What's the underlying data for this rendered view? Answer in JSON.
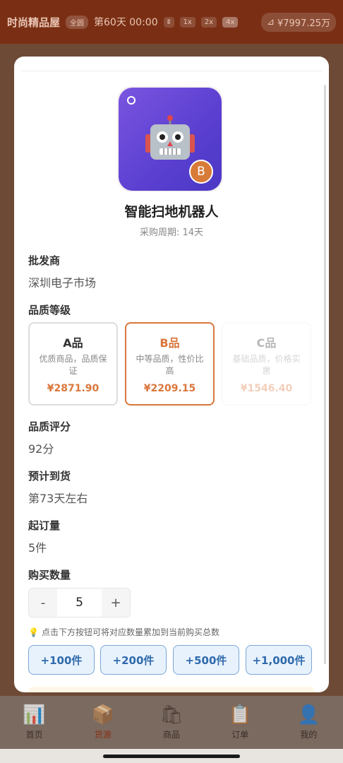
{
  "topbar": {
    "shop_name": "时尚精品屋",
    "mode_badge": "全圆",
    "day": "第60天 00:00",
    "speeds": [
      "Ⅱ",
      "1x",
      "2x",
      "4x"
    ],
    "money": "¥7997.25万"
  },
  "product": {
    "name": "智能扫地机器人",
    "cycle": "采购周期: 14天",
    "grade_badge": "B"
  },
  "wholesaler": {
    "label": "批发商",
    "value": "深圳电子市场"
  },
  "quality": {
    "label": "品质等级",
    "grades": [
      {
        "name": "A品",
        "desc": "优质商品，品质保证",
        "price": "¥2871.90"
      },
      {
        "name": "B品",
        "desc": "中等品质，性价比高",
        "price": "¥2209.15"
      },
      {
        "name": "C品",
        "desc": "基础品质，价格实惠",
        "price": "¥1546.40"
      }
    ],
    "selected_index": 1
  },
  "score": {
    "label": "品质评分",
    "value": "92分"
  },
  "arrival": {
    "label": "预计到货",
    "value": "第73天左右"
  },
  "moq": {
    "label": "起订量",
    "value": "5件"
  },
  "quantity": {
    "label": "购买数量",
    "minus": "-",
    "value": "5",
    "plus": "+",
    "hint": "点击下方按钮可将对应数量累加到当前购买总数",
    "quick_buttons": [
      "+100件",
      "+200件",
      "+500件",
      "+1,000件"
    ]
  },
  "nav": [
    {
      "label": "首页",
      "icon": "📊"
    },
    {
      "label": "货源",
      "icon": "📦"
    },
    {
      "label": "商品",
      "icon": "🛍"
    },
    {
      "label": "订单",
      "icon": "📋"
    },
    {
      "label": "我的",
      "icon": "👤"
    }
  ],
  "colors": {
    "accent": "#d9773c",
    "quick_button": "#2f6aac",
    "tile": "#5a3fd0"
  }
}
